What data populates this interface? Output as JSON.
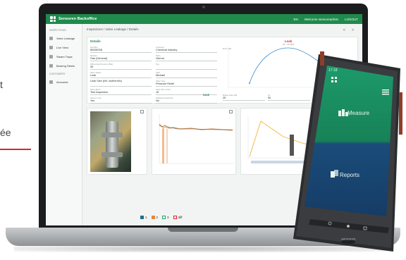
{
  "page_fragments": {
    "left_top": "t",
    "left_bottom": "ée"
  },
  "app": {
    "brand": "Sensoren Backoffice",
    "lang": "EN",
    "welcome": "Welcome sensoreadmin",
    "logout": "LOGOUT",
    "sidebar": {
      "section_inspections": "INSPECTIONS",
      "section_customers": "CUSTOMERS",
      "items": [
        {
          "label": "Valve Leakage",
          "icon": "valve-icon"
        },
        {
          "label": "Live View",
          "icon": "eye-icon"
        },
        {
          "label": "Steam Traps",
          "icon": "trap-icon"
        },
        {
          "label": "Bearing Steels",
          "icon": "bearing-icon"
        },
        {
          "label": "Accounts",
          "icon": "people-icon"
        }
      ]
    },
    "breadcrumb": "Inspections / Valve Leakage / Details",
    "pager": "< >",
    "details": {
      "title": "Details",
      "fields": [
        {
          "label": "Identifier",
          "value": "80098768"
        },
        {
          "label": "Customer",
          "value": "Chemical Industry"
        },
        {
          "label": "Medium",
          "value": "Gas (General)"
        },
        {
          "label": "Plant",
          "value": "Vienna"
        },
        {
          "label": "Differential Pressure (Bar)",
          "value": "35"
        },
        {
          "label": "Tag",
          "value": ""
        },
        {
          "label": "Valve Status",
          "value": "Leak"
        },
        {
          "label": "Staff",
          "value": "Michael"
        },
        {
          "label": "",
          "value": "Leak Size (l/hr. Isothermic)"
        },
        {
          "label": "Valve Type",
          "value": "Pressure Relief"
        },
        {
          "label": "Valve Batch",
          "value": "Test Inspection"
        },
        {
          "label": "Valve Size (inch)",
          "value": "15"
        },
        {
          "label": "Sensor Lock",
          "value": "Yes"
        },
        {
          "label": "Validated Inspection",
          "value": "No"
        }
      ],
      "save": "SAVE",
      "auto_text": "AUTOMATED RESULTS"
    },
    "leak_chart": {
      "title": "Leak",
      "subtitle": "25 · 18 dB/s",
      "ylabel": "Rms (db)"
    },
    "leak_lower": [
      {
        "label": "Bridge Gate (all)",
        "value": "25"
      },
      {
        "label": "Ac",
        "value": "50"
      },
      {
        "label": "",
        "value": "7"
      }
    ],
    "legend": [
      {
        "label": "1",
        "checked": true,
        "color": "#1f6f8c"
      },
      {
        "label": "2",
        "checked": true,
        "color": "#e8853a"
      },
      {
        "label": "3",
        "checked": false,
        "color": "#2aa070"
      },
      {
        "label": "diff",
        "checked": false,
        "color": "#d9262c"
      }
    ]
  },
  "phone": {
    "time": "17:18",
    "measure": "Measure",
    "reports": "Reports",
    "brand_mark": "sensoren"
  }
}
